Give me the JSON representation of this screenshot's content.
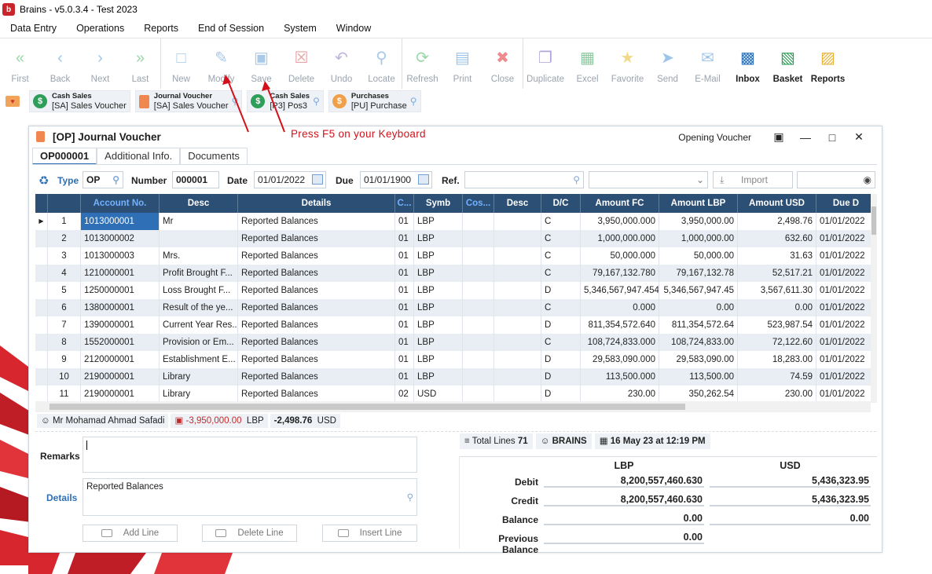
{
  "window": {
    "title": "Brains - v5.0.3.4 - Test 2023",
    "logo": "b"
  },
  "menu": [
    "Data Entry",
    "Operations",
    "Reports",
    "End of Session",
    "System",
    "Window"
  ],
  "toolbar": {
    "groups": [
      [
        {
          "label": "First",
          "icon": "first-icon"
        },
        {
          "label": "Back",
          "icon": "back-icon"
        },
        {
          "label": "Next",
          "icon": "next-icon"
        },
        {
          "label": "Last",
          "icon": "last-icon"
        }
      ],
      [
        {
          "label": "New",
          "icon": "new-icon"
        },
        {
          "label": "Modify",
          "icon": "modify-icon"
        },
        {
          "label": "Save",
          "icon": "save-icon"
        },
        {
          "label": "Delete",
          "icon": "delete-icon"
        },
        {
          "label": "Undo",
          "icon": "undo-icon"
        },
        {
          "label": "Locate",
          "icon": "locate-icon"
        }
      ],
      [
        {
          "label": "Refresh",
          "icon": "refresh-icon"
        },
        {
          "label": "Print",
          "icon": "print-icon"
        },
        {
          "label": "Close",
          "icon": "close-icon"
        }
      ],
      [
        {
          "label": "Duplicate",
          "icon": "duplicate-icon"
        },
        {
          "label": "Excel",
          "icon": "excel-icon"
        },
        {
          "label": "Favorite",
          "icon": "favorite-icon"
        },
        {
          "label": "Send",
          "icon": "send-icon"
        },
        {
          "label": "E-Mail",
          "icon": "email-icon"
        },
        {
          "label": "Inbox",
          "icon": "inbox-icon",
          "enabled": true
        },
        {
          "label": "Basket",
          "icon": "basket-icon",
          "enabled": true
        },
        {
          "label": "Reports",
          "icon": "reports-icon",
          "enabled": true
        }
      ]
    ]
  },
  "shortcuts": [
    {
      "title": "Cash Sales",
      "sub": "[SA] Sales Voucher",
      "color": "#2e9e5a",
      "glyph": "$"
    },
    {
      "title": "Journal Voucher",
      "sub": "[SA] Sales Voucher",
      "color": "#f0874e",
      "glyph": ""
    },
    {
      "title": "Cash Sales",
      "sub": "[P3] Pos3",
      "color": "#2e9e5a",
      "glyph": "$"
    },
    {
      "title": "Purchases",
      "sub": "[PU] Purchase",
      "color": "#f0a04a",
      "glyph": "$"
    }
  ],
  "hint": "Press F5 on your Keyboard",
  "form": {
    "title": "[OP] Journal Voucher",
    "mode": "Opening Voucher",
    "tabs": [
      "OP000001",
      "Additional Info.",
      "Documents"
    ],
    "type_label": "Type",
    "type_value": "OP",
    "number_label": "Number",
    "number_value": "000001",
    "date_label": "Date",
    "date_value": "01/01/2022",
    "due_label": "Due",
    "due_value": "01/01/1900",
    "ref_label": "Ref.",
    "import_label": "Import",
    "columns": [
      "",
      "",
      "Account No.",
      "Desc",
      "Details",
      "C...",
      "Symb",
      "Cos...",
      "Desc",
      "D/C",
      "Amount FC",
      "Amount LBP",
      "Amount USD",
      "Due D"
    ],
    "rows": [
      [
        "1",
        "1013000001",
        "Mr",
        "Reported Balances",
        "01",
        "LBP",
        "",
        "",
        "C",
        "3,950,000.000",
        "3,950,000.00",
        "2,498.76",
        "01/01/2022"
      ],
      [
        "2",
        "1013000002",
        "",
        "Reported Balances",
        "01",
        "LBP",
        "",
        "",
        "C",
        "1,000,000.000",
        "1,000,000.00",
        "632.60",
        "01/01/2022"
      ],
      [
        "3",
        "1013000003",
        "Mrs.",
        "Reported Balances",
        "01",
        "LBP",
        "",
        "",
        "C",
        "50,000.000",
        "50,000.00",
        "31.63",
        "01/01/2022"
      ],
      [
        "4",
        "1210000001",
        "Profit Brought F...",
        "Reported Balances",
        "01",
        "LBP",
        "",
        "",
        "C",
        "79,167,132.780",
        "79,167,132.78",
        "52,517.21",
        "01/01/2022"
      ],
      [
        "5",
        "1250000001",
        "Loss Brought F...",
        "Reported Balances",
        "01",
        "LBP",
        "",
        "",
        "D",
        "5,346,567,947.454",
        "5,346,567,947.45",
        "3,567,611.30",
        "01/01/2022"
      ],
      [
        "6",
        "1380000001",
        "Result of the ye...",
        "Reported Balances",
        "01",
        "LBP",
        "",
        "",
        "C",
        "0.000",
        "0.00",
        "0.00",
        "01/01/2022"
      ],
      [
        "7",
        "1390000001",
        "Current Year Res...",
        "Reported Balances",
        "01",
        "LBP",
        "",
        "",
        "D",
        "811,354,572.640",
        "811,354,572.64",
        "523,987.54",
        "01/01/2022"
      ],
      [
        "8",
        "1552000001",
        "Provision or Em...",
        "Reported Balances",
        "01",
        "LBP",
        "",
        "",
        "C",
        "108,724,833.000",
        "108,724,833.00",
        "72,122.60",
        "01/01/2022"
      ],
      [
        "9",
        "2120000001",
        "Establishment E...",
        "Reported Balances",
        "01",
        "LBP",
        "",
        "",
        "D",
        "29,583,090.000",
        "29,583,090.00",
        "18,283.00",
        "01/01/2022"
      ],
      [
        "10",
        "2190000001",
        "Library",
        "Reported Balances",
        "01",
        "LBP",
        "",
        "",
        "D",
        "113,500.000",
        "113,500.00",
        "74.59",
        "01/01/2022"
      ],
      [
        "11",
        "2190000001",
        "Library",
        "Reported Balances",
        "02",
        "USD",
        "",
        "",
        "D",
        "230.00",
        "350,262.54",
        "230.00",
        "01/01/2022"
      ]
    ],
    "info": {
      "user": "Mr Mohamad Ahmad Safadi",
      "balance_lbp": "-3,950,000.00",
      "currency_lbp": "LBP",
      "balance_usd": "-2,498.76",
      "currency_usd": "USD"
    },
    "remarks_label": "Remarks",
    "details_label": "Details",
    "details_value": "Reported Balances",
    "add_line": "Add Line",
    "delete_line": "Delete Line",
    "insert_line": "Insert Line",
    "total_lines_label": "Total Lines",
    "total_lines": "71",
    "brains_user": "BRAINS",
    "timestamp": "16 May 23 at 12:19 PM",
    "totals": {
      "col_lbp": "LBP",
      "col_usd": "USD",
      "debit_label": "Debit",
      "credit_label": "Credit",
      "balance_label": "Balance",
      "prev_label": "Previous Balance",
      "debit_lbp": "8,200,557,460.630",
      "debit_usd": "5,436,323.95",
      "credit_lbp": "8,200,557,460.630",
      "credit_usd": "5,436,323.95",
      "balance_lbp": "0.00",
      "balance_usd": "0.00",
      "prev_lbp": "0.00"
    }
  }
}
